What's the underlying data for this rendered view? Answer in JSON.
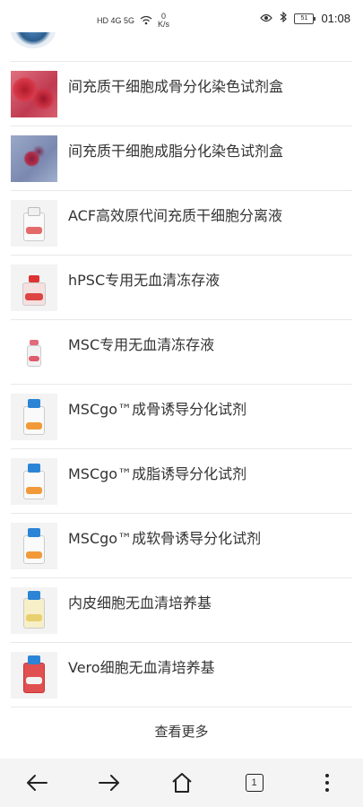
{
  "status_bar": {
    "network": "HD 4G 5G",
    "speed_value": "0",
    "speed_unit": "K/s",
    "battery": "51",
    "time": "01:08"
  },
  "products": [
    {
      "title": "间充质干细胞成骨分化染色试剂盒",
      "thumb": "stain-red-photo"
    },
    {
      "title": "间充质干细胞成脂分化染色试剂盒",
      "thumb": "stain-blue-photo"
    },
    {
      "title": "ACF高效原代间充质干细胞分离液",
      "thumb": "bottle-photo"
    },
    {
      "title": "hPSC专用无血清冻存液",
      "thumb": "bottle-photo"
    },
    {
      "title": "MSC专用无血清冻存液",
      "thumb": "vial-photo"
    },
    {
      "title": "MSCgo™成骨诱导分化试剂",
      "thumb": "blue-cap-bottle-photo"
    },
    {
      "title": "MSCgo™成脂诱导分化试剂",
      "thumb": "blue-cap-bottle-photo"
    },
    {
      "title": "MSCgo™成软骨诱导分化试剂",
      "thumb": "blue-cap-bottle-photo"
    },
    {
      "title": "内皮细胞无血清培养基",
      "thumb": "yellow-bottle-photo"
    },
    {
      "title": "Vero细胞无血清培养基",
      "thumb": "red-bottle-photo"
    }
  ],
  "more_label": "查看更多",
  "nav": {
    "tab_count": "1",
    "icons": [
      "back-arrow-icon",
      "forward-arrow-icon",
      "home-icon",
      "tabs-icon",
      "more-vertical-icon"
    ]
  }
}
